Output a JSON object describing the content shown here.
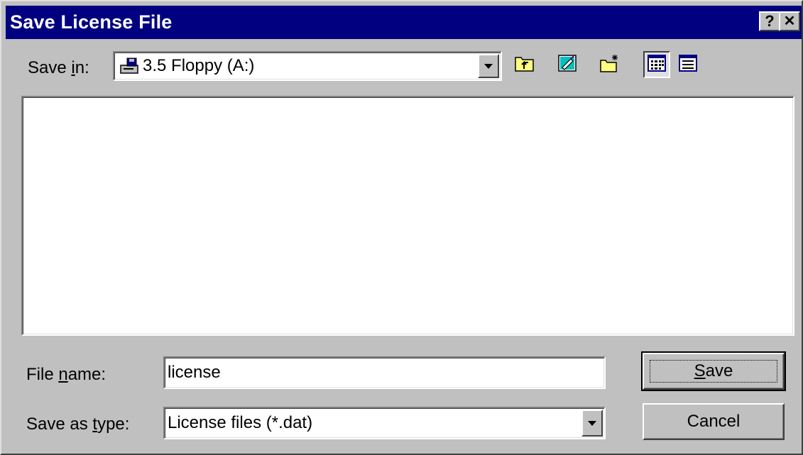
{
  "window": {
    "title": "Save License File",
    "help_glyph": "?",
    "close_glyph": "✕"
  },
  "save_in": {
    "label_pre": "Save ",
    "label_accel": "i",
    "label_post": "n:",
    "value": "3.5 Floppy (A:)"
  },
  "toolbar": {
    "icons": [
      "up-one-level-icon",
      "desktop-icon",
      "new-folder-icon",
      "list-view-icon",
      "details-view-icon"
    ]
  },
  "file_name": {
    "label_pre": "File ",
    "label_accel": "n",
    "label_post": "ame:",
    "value": "license"
  },
  "save_as_type": {
    "label_pre": "Save as ",
    "label_accel": "t",
    "label_post": "ype:",
    "value": "License files (*.dat)"
  },
  "buttons": {
    "save_accel": "S",
    "save_rest": "ave",
    "cancel": "Cancel"
  },
  "colors": {
    "titlebar": "#000080",
    "face": "#c0c0c0"
  }
}
